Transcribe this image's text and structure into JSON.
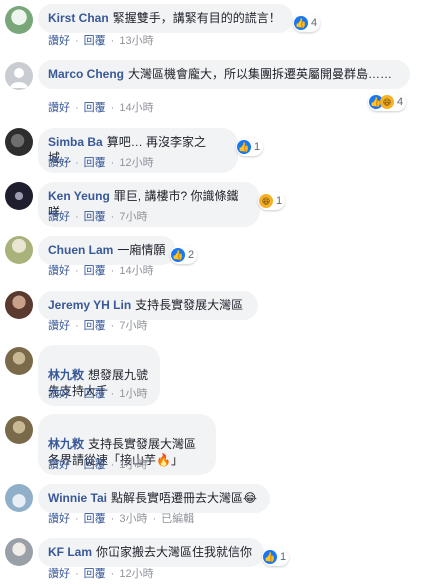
{
  "labels": {
    "like": "讚好",
    "reply": "回覆",
    "edited": "已編輯"
  },
  "comments": [
    {
      "name": "Kirst Chan",
      "text": "緊握雙手，講緊有目的的謊言！",
      "time": "13小時",
      "reactions": "4",
      "icons": [
        "like-icon"
      ],
      "avatar_color": "#7aa77a"
    },
    {
      "name": "Marco Cheng",
      "text": "大灣區機會龐大，所以集團拆遷英屬開曼群島……",
      "time": "14小時",
      "reactions": "4",
      "icons": [
        "like-icon",
        "haha-icon"
      ],
      "avatar_color": "#c9ccd1"
    },
    {
      "name": "Simba Ba",
      "text": "算吧… 再沒李家之城…",
      "time": "12小時",
      "reactions": "1",
      "icons": [
        "like-icon"
      ],
      "avatar_color": "#3a3a3a"
    },
    {
      "name": "Ken Yeung",
      "text": "罪巨, 講樓市? 你識條鐵咩",
      "time": "7小時",
      "reactions": "1",
      "icons": [
        "haha-icon"
      ],
      "avatar_color": "#2b2b3a"
    },
    {
      "name": "Chuen Lam",
      "text": "一廂情願",
      "time": "14小時",
      "reactions": "2",
      "icons": [
        "like-icon"
      ],
      "avatar_color": "#b7c08a"
    },
    {
      "name": "Jeremy YH Lin",
      "text": "支持長實發展大灣區",
      "time": "7小時",
      "reactions": "",
      "icons": [],
      "avatar_color": "#6a4a3a"
    },
    {
      "name": "林九敉",
      "text": "想發展九號\n先支持大千",
      "time": "1小時",
      "reactions": "",
      "icons": [],
      "avatar_color": "#8a7a5a"
    },
    {
      "name": "林九敉",
      "text": "支持長實發展大灣區\n各界請從速「接山芋🔥」",
      "time": "1小時",
      "reactions": "",
      "icons": [],
      "avatar_color": "#8a7a5a"
    },
    {
      "name": "Winnie Tai",
      "text": "點解長實唔遷冊去大灣區😂",
      "time": "3小時",
      "reactions": "",
      "icons": [],
      "avatar_color": "#8fb0c8",
      "edited": true
    },
    {
      "name": "KF Lam",
      "text": "你冚家搬去大灣區住我就信你",
      "time": "12小時",
      "reactions": "1",
      "icons": [
        "like-icon"
      ],
      "avatar_color": "#9aa0a8"
    }
  ]
}
